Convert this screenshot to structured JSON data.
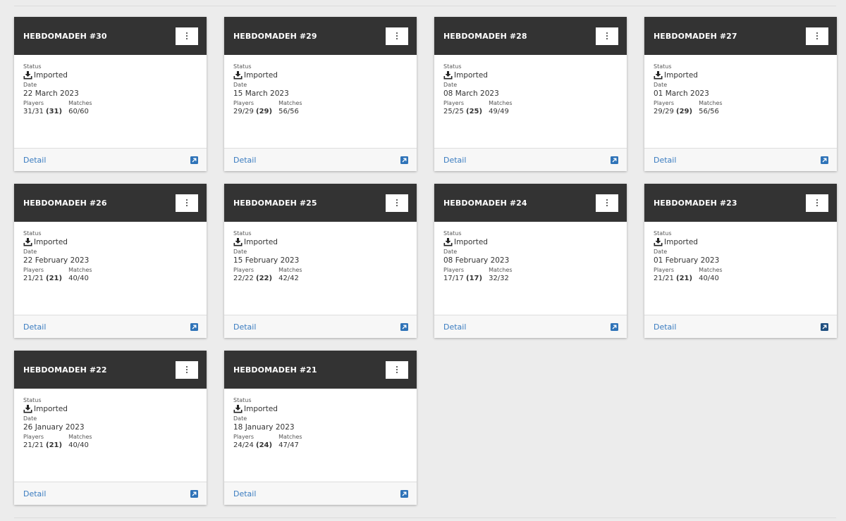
{
  "cards": [
    {
      "title": "HEBDOMADEH #30",
      "status_label": "Status",
      "status": "Imported",
      "date_label": "Date",
      "date": "22 March 2023",
      "players_label": "Players",
      "players": "31/31",
      "players_bold": "(31)",
      "matches_label": "Matches",
      "matches": "60/60",
      "detail": "Detail"
    },
    {
      "title": "HEBDOMADEH #29",
      "status_label": "Status",
      "status": "Imported",
      "date_label": "Date",
      "date": "15 March 2023",
      "players_label": "Players",
      "players": "29/29",
      "players_bold": "(29)",
      "matches_label": "Matches",
      "matches": "56/56",
      "detail": "Detail"
    },
    {
      "title": "HEBDOMADEH #28",
      "status_label": "Status",
      "status": "Imported",
      "date_label": "Date",
      "date": "08 March 2023",
      "players_label": "Players",
      "players": "25/25",
      "players_bold": "(25)",
      "matches_label": "Matches",
      "matches": "49/49",
      "detail": "Detail"
    },
    {
      "title": "HEBDOMADEH #27",
      "status_label": "Status",
      "status": "Imported",
      "date_label": "Date",
      "date": "01 March 2023",
      "players_label": "Players",
      "players": "29/29",
      "players_bold": "(29)",
      "matches_label": "Matches",
      "matches": "56/56",
      "detail": "Detail"
    },
    {
      "title": "HEBDOMADEH #26",
      "status_label": "Status",
      "status": "Imported",
      "date_label": "Date",
      "date": "22 February 2023",
      "players_label": "Players",
      "players": "21/21",
      "players_bold": "(21)",
      "matches_label": "Matches",
      "matches": "40/40",
      "detail": "Detail"
    },
    {
      "title": "HEBDOMADEH #25",
      "status_label": "Status",
      "status": "Imported",
      "date_label": "Date",
      "date": "15 February 2023",
      "players_label": "Players",
      "players": "22/22",
      "players_bold": "(22)",
      "matches_label": "Matches",
      "matches": "42/42",
      "detail": "Detail"
    },
    {
      "title": "HEBDOMADEH #24",
      "status_label": "Status",
      "status": "Imported",
      "date_label": "Date",
      "date": "08 February 2023",
      "players_label": "Players",
      "players": "17/17",
      "players_bold": "(17)",
      "matches_label": "Matches",
      "matches": "32/32",
      "detail": "Detail"
    },
    {
      "title": "HEBDOMADEH #23",
      "status_label": "Status",
      "status": "Imported",
      "date_label": "Date",
      "date": "01 February 2023",
      "players_label": "Players",
      "players": "21/21",
      "players_bold": "(21)",
      "matches_label": "Matches",
      "matches": "40/40",
      "detail": "Detail"
    },
    {
      "title": "HEBDOMADEH #22",
      "status_label": "Status",
      "status": "Imported",
      "date_label": "Date",
      "date": "26 January 2023",
      "players_label": "Players",
      "players": "21/21",
      "players_bold": "(21)",
      "matches_label": "Matches",
      "matches": "40/40",
      "detail": "Detail"
    },
    {
      "title": "HEBDOMADEH #21",
      "status_label": "Status",
      "status": "Imported",
      "date_label": "Date",
      "date": "18 January 2023",
      "players_label": "Players",
      "players": "24/24",
      "players_bold": "(24)",
      "matches_label": "Matches",
      "matches": "47/47",
      "detail": "Detail"
    }
  ],
  "icons": {
    "menu": "more-vert-icon",
    "status": "download-icon",
    "external": "open-external-icon"
  },
  "colors": {
    "header_bg": "#333333",
    "link": "#3a7cc0",
    "external_icon": "#2f73b8",
    "page_bg": "#ececec"
  }
}
